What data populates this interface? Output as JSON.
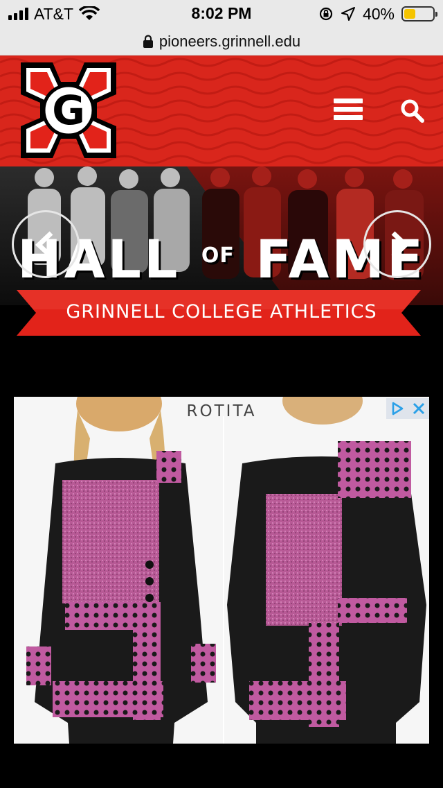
{
  "status_bar": {
    "carrier": "AT&T",
    "time": "8:02 PM",
    "battery_percent": "40%",
    "battery_level": 0.4,
    "icons": [
      "signal-icon",
      "wifi-icon",
      "orientation-lock-icon",
      "location-icon",
      "battery-icon"
    ]
  },
  "browser": {
    "url": "pioneers.grinnell.edu",
    "lock_icon": "lock-icon"
  },
  "header": {
    "logo_letter": "G",
    "menu_icon": "hamburger-menu-icon",
    "search_icon": "search-icon",
    "brand_color": "#d9261c"
  },
  "hero": {
    "title_left": "HALL",
    "title_of": "OF",
    "title_right": "FAME",
    "subtitle": "GRINNELL COLLEGE ATHLETICS",
    "prev_icon": "chevron-left-icon",
    "next_icon": "chevron-right-icon",
    "banner_color": "#e2231a"
  },
  "ad": {
    "brand": "ROTITA",
    "adchoices_icon": "adchoices-icon",
    "close_icon": "close-icon",
    "accent_color": "#c05aa0"
  }
}
